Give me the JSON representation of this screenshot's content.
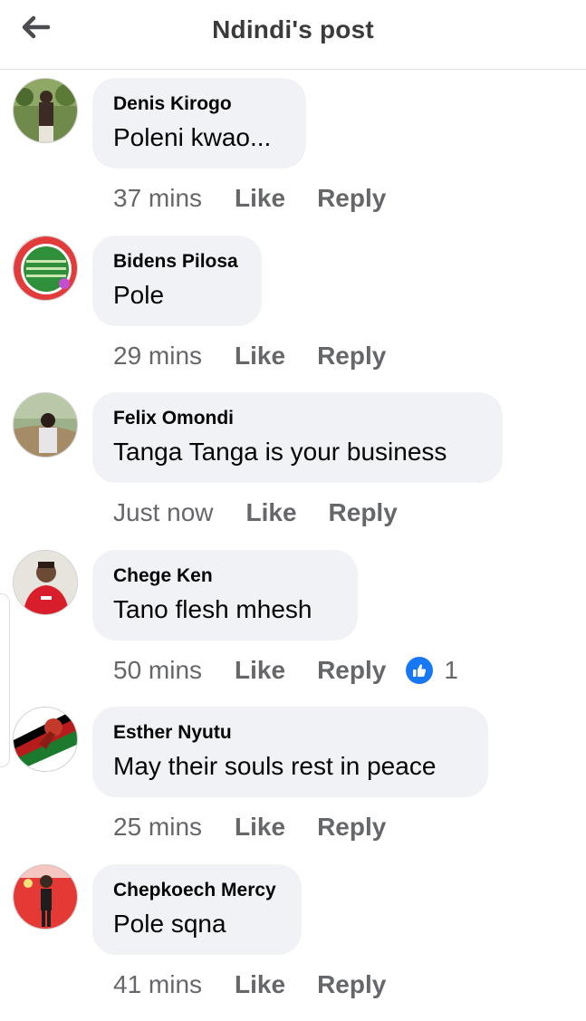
{
  "header": {
    "title": "Ndindi's post",
    "back_icon": "arrow-left-icon"
  },
  "actions": {
    "like": "Like",
    "reply": "Reply"
  },
  "colors": {
    "bubble": "#f0f2f5",
    "meta_text": "#65676b",
    "like_blue": "#1877f2"
  },
  "comments": [
    {
      "author": "Denis Kirogo",
      "text": "Poleni kwao...",
      "time": "37 mins"
    },
    {
      "author": "Bidens Pilosa",
      "text": "Pole",
      "time": "29 mins"
    },
    {
      "author": "Felix Omondi",
      "text": "Tanga Tanga is your business",
      "time": "Just now"
    },
    {
      "author": "Chege Ken",
      "text": "Tano flesh mhesh",
      "time": "50 mins",
      "reactions": {
        "icon": "thumbs-up-icon",
        "count": "1"
      }
    },
    {
      "author": "Esther Nyutu",
      "text": "May their souls rest in peace",
      "time": "25 mins"
    },
    {
      "author": "Chepkoech Mercy",
      "text": "Pole sqna",
      "time": "41 mins"
    }
  ]
}
